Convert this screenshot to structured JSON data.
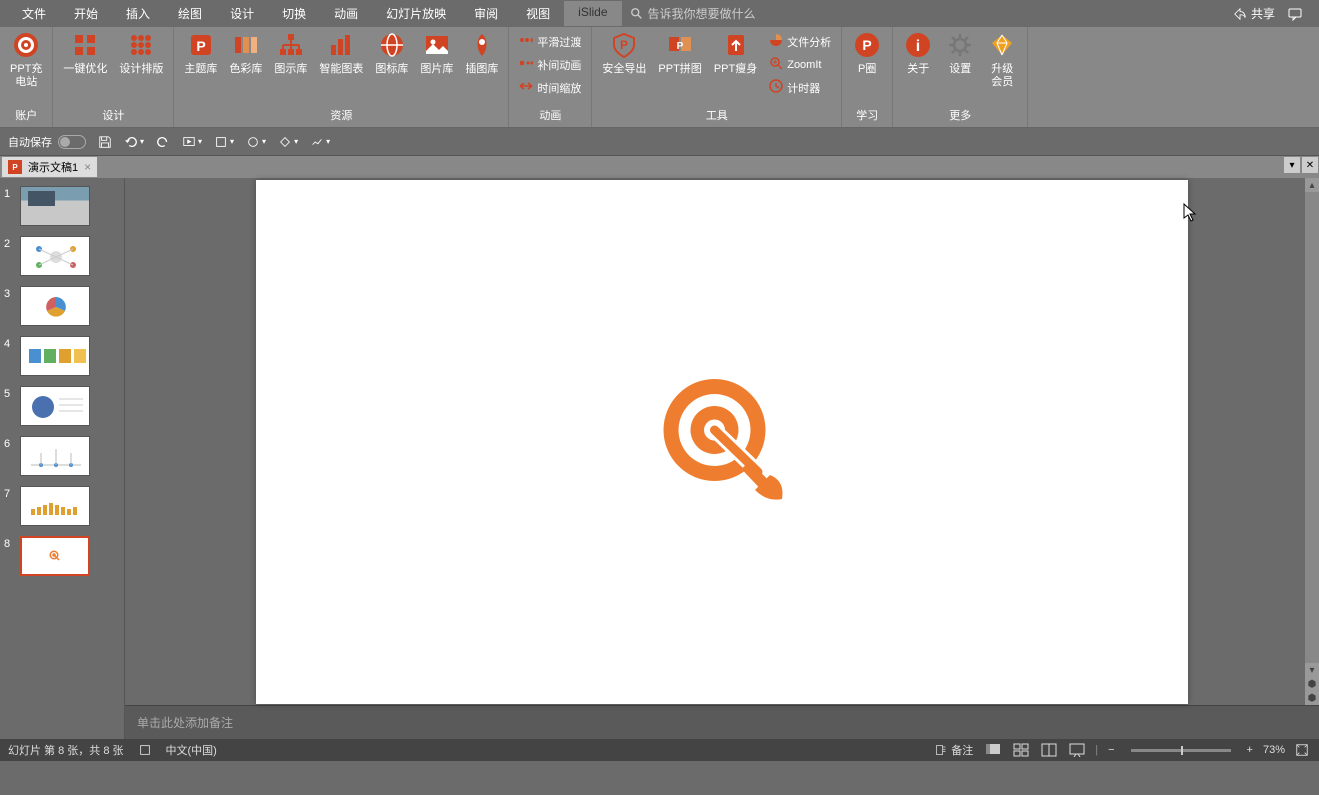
{
  "menu": {
    "items": [
      "文件",
      "开始",
      "插入",
      "绘图",
      "设计",
      "切换",
      "动画",
      "幻灯片放映",
      "审阅",
      "视图",
      "iSlide"
    ],
    "active": 10,
    "search_placeholder": "告诉我你想要做什么",
    "share": "共享"
  },
  "ribbon": {
    "groups": [
      {
        "label": "账户",
        "items": [
          {
            "name": "ppt-station",
            "label": "PPT充\n电站",
            "icon": "target",
            "color": "#d04423"
          }
        ]
      },
      {
        "label": "设计",
        "items": [
          {
            "name": "one-click",
            "label": "一键优化",
            "icon": "grid4",
            "color": "#d04423"
          },
          {
            "name": "design-layout",
            "label": "设计排版",
            "icon": "dots",
            "color": "#d04423"
          }
        ]
      },
      {
        "label": "资源",
        "items": [
          {
            "name": "theme-lib",
            "label": "主题库",
            "icon": "ppt-box",
            "color": "#d04423"
          },
          {
            "name": "color-lib",
            "label": "色彩库",
            "icon": "palette",
            "color": "#d04423"
          },
          {
            "name": "diagram-lib",
            "label": "图示库",
            "icon": "org",
            "color": "#d04423"
          },
          {
            "name": "smart-chart",
            "label": "智能图表",
            "icon": "bars",
            "color": "#d04423"
          },
          {
            "name": "icon-lib",
            "label": "图标库",
            "icon": "globe",
            "color": "#d04423"
          },
          {
            "name": "pic-lib",
            "label": "图片库",
            "icon": "image",
            "color": "#d04423"
          },
          {
            "name": "illus-lib",
            "label": "插图库",
            "icon": "rocket",
            "color": "#d04423"
          }
        ]
      },
      {
        "label": "动画",
        "small_items": [
          {
            "name": "smooth",
            "label": "平滑过渡",
            "icon": "dots-arrow"
          },
          {
            "name": "tween",
            "label": "补间动画",
            "icon": "dots-sq"
          },
          {
            "name": "time-scale",
            "label": "时间缩放",
            "icon": "arrows-h"
          }
        ]
      },
      {
        "label": "工具",
        "items": [
          {
            "name": "safe-export",
            "label": "安全导出",
            "icon": "shield-p",
            "color": "#d04423"
          },
          {
            "name": "ppt-merge",
            "label": "PPT拼图",
            "icon": "merge",
            "color": "#d04423"
          },
          {
            "name": "ppt-slim",
            "label": "PPT瘦身",
            "icon": "slim",
            "color": "#d04423"
          }
        ],
        "small_items": [
          {
            "name": "file-analysis",
            "label": "文件分析",
            "icon": "pie"
          },
          {
            "name": "zoomit",
            "label": "ZoomIt",
            "icon": "zoom"
          },
          {
            "name": "timer",
            "label": "计时器",
            "icon": "clock"
          }
        ]
      },
      {
        "label": "学习",
        "items": [
          {
            "name": "p-circle",
            "label": "P圈",
            "icon": "p-badge",
            "color": "#d04423"
          }
        ]
      },
      {
        "label": "更多",
        "items": [
          {
            "name": "about",
            "label": "关于",
            "icon": "info",
            "color": "#d04423"
          },
          {
            "name": "settings",
            "label": "设置",
            "icon": "gear",
            "color": "#777"
          },
          {
            "name": "upgrade",
            "label": "升级\n会员",
            "icon": "diamond",
            "color": "#f0a020"
          }
        ]
      }
    ]
  },
  "qat": {
    "autosave": "自动保存"
  },
  "doc": {
    "title": "演示文稿1"
  },
  "slides": {
    "count": 8,
    "active": 8
  },
  "notes": {
    "placeholder": "单击此处添加备注"
  },
  "status": {
    "slide_info": "幻灯片 第 8 张，共 8 张",
    "lang": "中文(中国)",
    "notes_btn": "备注",
    "zoom": "73%"
  }
}
